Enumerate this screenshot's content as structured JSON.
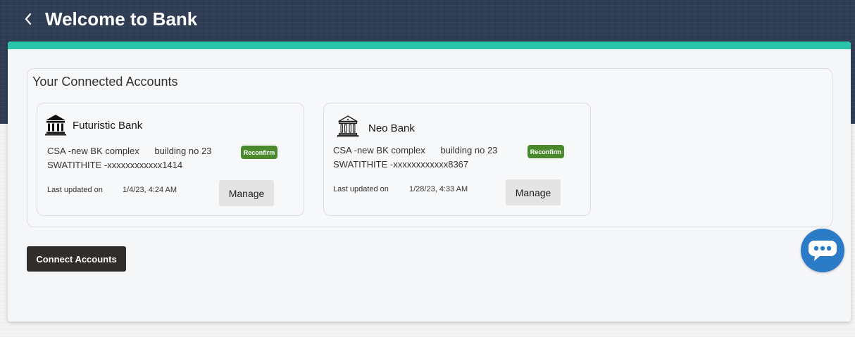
{
  "header": {
    "title": "Welcome to Bank",
    "back_icon": "chevron-left-icon"
  },
  "colors": {
    "accent": "#2bc4a9",
    "badge": "#4a8a2c",
    "primary_button": "#312d2a",
    "chat": "#2a7cc7"
  },
  "section": {
    "title": "Your Connected Accounts"
  },
  "accounts": [
    {
      "bank_name": "Futuristic Bank",
      "icon": "bank-building-icon",
      "address_line1": "CSA -new BK complex      building no 23",
      "address_line2": "SWATITHITE -xxxxxxxxxxxx1414",
      "badge": "Reconfirm",
      "updated_label": "Last updated on",
      "updated_value": "1/4/23, 4:24 AM",
      "manage_label": "Manage"
    },
    {
      "bank_name": "Neo Bank",
      "icon": "bank-building-outline-icon",
      "address_line1": "CSA -new BK complex      building no 23",
      "address_line2": "SWATITHITE -xxxxxxxxxxxx8367",
      "badge": "Reconfirm",
      "updated_label": "Last updated on",
      "updated_value": "1/28/23, 4:33 AM",
      "manage_label": "Manage"
    }
  ],
  "actions": {
    "connect_label": "Connect Accounts"
  },
  "chat": {
    "icon": "chat-bubble-icon"
  }
}
